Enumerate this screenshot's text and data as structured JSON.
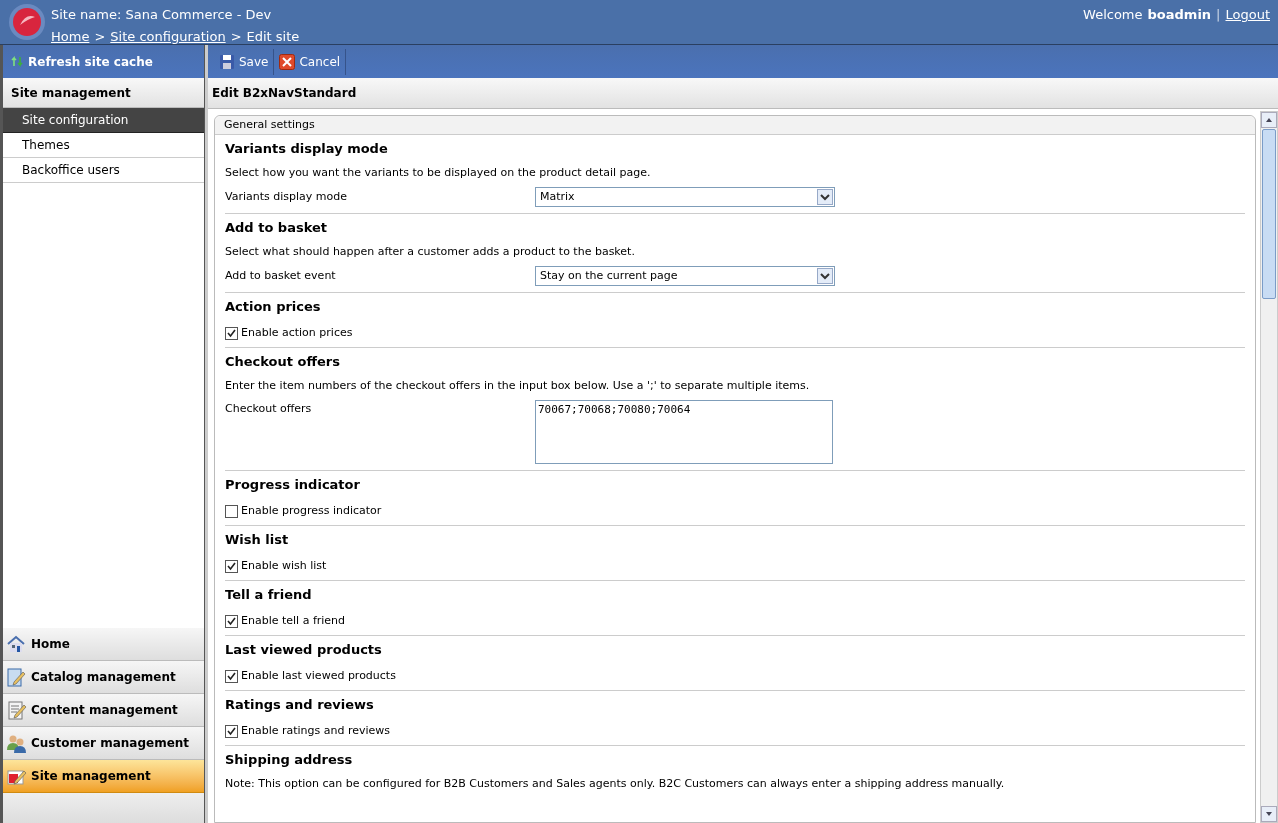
{
  "header": {
    "site_name": "Site name: Sana Commerce - Dev",
    "breadcrumb": [
      {
        "kind": "link",
        "label": "Home"
      },
      {
        "kind": "separator",
        "label": ">"
      },
      {
        "kind": "link",
        "label": "Site configuration"
      },
      {
        "kind": "separator",
        "label": ">"
      },
      {
        "kind": "current",
        "label": "Edit site"
      }
    ],
    "welcome": "Welcome",
    "user": "boadmin",
    "separator": "|",
    "logout": "Logout"
  },
  "sidebar": {
    "refresh": "Refresh site cache",
    "title": "Site management",
    "items": [
      {
        "label": "Site configuration",
        "selected": true
      },
      {
        "label": "Themes",
        "selected": false
      },
      {
        "label": "Backoffice users",
        "selected": false
      }
    ],
    "modules": [
      {
        "label": "Home",
        "selected": false
      },
      {
        "label": "Catalog management",
        "selected": false
      },
      {
        "label": "Content management",
        "selected": false
      },
      {
        "label": "Customer management",
        "selected": false
      },
      {
        "label": "Site management",
        "selected": true
      }
    ]
  },
  "toolbar": [
    {
      "label": "Save"
    },
    {
      "label": "Cancel"
    }
  ],
  "page_title": "Edit B2xNavStandard",
  "panel_title": "General settings",
  "sections": [
    {
      "title": "Variants display mode",
      "description": "Select how you want the variants to be displayed on the product detail page.",
      "kind": "select",
      "label": "Variants display mode",
      "value": "Matrix"
    },
    {
      "title": "Add to basket",
      "description": "Select what should happen after a customer adds a product to the basket.",
      "kind": "select",
      "label": "Add to basket event",
      "value": "Stay on the current page"
    },
    {
      "title": "Action prices",
      "kind": "checkbox",
      "label": "Enable action prices",
      "checked": true
    },
    {
      "title": "Checkout offers",
      "description": "Enter the item numbers of the checkout offers in the input box below. Use a ';' to separate multiple items.",
      "kind": "textarea",
      "label": "Checkout offers",
      "value": "70067;70068;70080;70064"
    },
    {
      "title": "Progress indicator",
      "kind": "checkbox",
      "label": "Enable progress indicator",
      "checked": false
    },
    {
      "title": "Wish list",
      "kind": "checkbox",
      "label": "Enable wish list",
      "checked": true
    },
    {
      "title": "Tell a friend",
      "kind": "checkbox",
      "label": "Enable tell a friend",
      "checked": true
    },
    {
      "title": "Last viewed products",
      "kind": "checkbox",
      "label": "Enable last viewed products",
      "checked": true
    },
    {
      "title": "Ratings and reviews",
      "kind": "checkbox",
      "label": "Enable ratings and reviews",
      "checked": true
    },
    {
      "title": "Shipping address",
      "description": "Note: This option can be configured for B2B Customers and Sales agents only. B2C Customers can always enter a shipping address manually.",
      "kind": "note"
    }
  ]
}
